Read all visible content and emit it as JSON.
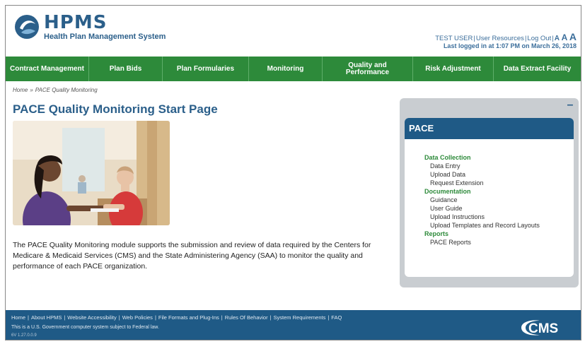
{
  "header": {
    "brand_name": "HPMS",
    "brand_subtitle": "Health Plan Management System",
    "user_name": "TEST USER",
    "user_resources": "User Resources",
    "logout": "Log Out",
    "font_sizes": [
      "A",
      "A",
      "A"
    ],
    "login_info": "Last logged in at 1:07 PM on March 26, 2018"
  },
  "nav": {
    "items": [
      {
        "label": "Contract Management"
      },
      {
        "label": "Plan Bids"
      },
      {
        "label": "Plan Formularies"
      },
      {
        "label": "Monitoring"
      },
      {
        "label": "Quality and Performance"
      },
      {
        "label": "Risk Adjustment"
      },
      {
        "label": "Data Extract Facility"
      }
    ]
  },
  "breadcrumb": {
    "home": "Home",
    "separator": "»",
    "current": "PACE Quality Monitoring"
  },
  "page": {
    "title": "PACE Quality Monitoring Start Page",
    "intro": "The PACE Quality Monitoring module supports the submission and review of data required by the Centers for Medicare & Medicaid Services (CMS) and the State Administering Agency (SAA) to monitor the quality and performance of each PACE organization."
  },
  "pace_panel": {
    "title": "PACE",
    "collapse": "–",
    "sections": [
      {
        "heading": "Data Collection",
        "links": [
          "Data Entry",
          "Upload Data",
          "Request Extension"
        ]
      },
      {
        "heading": "Documentation",
        "links": [
          "Guidance",
          "User Guide",
          "Upload Instructions",
          "Upload Templates and Record Layouts"
        ]
      },
      {
        "heading": "Reports",
        "links": [
          "PACE Reports"
        ]
      }
    ]
  },
  "footer": {
    "links": [
      "Home",
      "About HPMS",
      "Website Accessibility",
      "Web Policies",
      "File Formats and Plug-Ins",
      "Rules Of Behavior",
      "System Requirements",
      "FAQ"
    ],
    "note": "This is a U.S. Government computer system subject to Federal law.",
    "version": "6V 1.27.0.0.9",
    "logo_text": "CMS"
  },
  "colors": {
    "brand_blue": "#2b5f8a",
    "nav_green": "#2d8a3a",
    "panel_blue": "#1f5a86"
  }
}
